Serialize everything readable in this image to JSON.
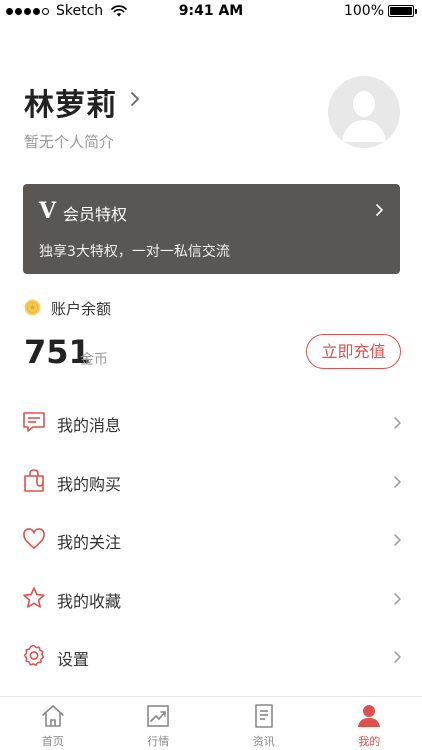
{
  "status_bar": {
    "carrier": "Sketch",
    "time": "9:41 AM",
    "battery": "100%"
  },
  "profile": {
    "name": "林萝莉",
    "bio": "暂无个人简介"
  },
  "vip": {
    "logo": "V",
    "title": "会员特权",
    "description": "独享3大特权，一对一私信交流"
  },
  "balance": {
    "label": "账户余额",
    "value": "751",
    "unit": "金币",
    "recharge_label": "立即充值"
  },
  "menu": {
    "items": [
      {
        "label": "我的消息",
        "icon": "message-icon"
      },
      {
        "label": "我的购买",
        "icon": "shopping-bag-icon"
      },
      {
        "label": "我的关注",
        "icon": "heart-icon"
      },
      {
        "label": "我的收藏",
        "icon": "star-icon"
      },
      {
        "label": "设置",
        "icon": "gear-icon"
      }
    ]
  },
  "tabbar": {
    "tabs": [
      {
        "label": "首页",
        "icon": "home-icon",
        "active": false
      },
      {
        "label": "行情",
        "icon": "chart-icon",
        "active": false
      },
      {
        "label": "资讯",
        "icon": "document-icon",
        "active": false
      },
      {
        "label": "我的",
        "icon": "person-icon",
        "active": true
      }
    ]
  },
  "colors": {
    "accent": "#e0514e",
    "vip_card": "#5a5654",
    "coin": "#f2c94c"
  }
}
